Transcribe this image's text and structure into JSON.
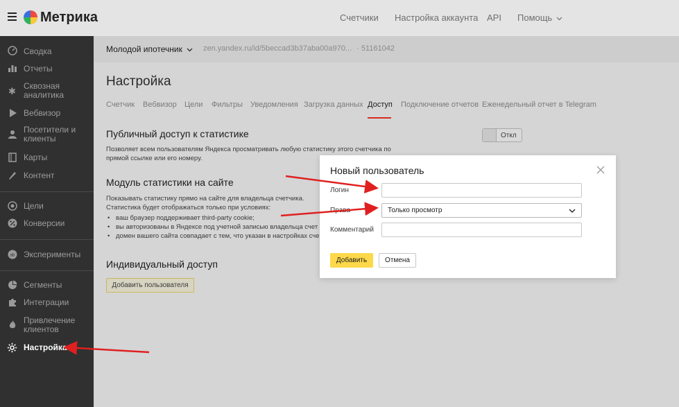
{
  "app": {
    "brand": "Метрика",
    "top_nav": [
      "Счетчики",
      "Настройка аккаунта",
      "API",
      "Помощь"
    ]
  },
  "sidebar": {
    "items": [
      {
        "label": "Сводка",
        "icon": "gauge-icon"
      },
      {
        "label": "Отчеты",
        "icon": "bar-chart-icon"
      },
      {
        "label": "Сквозная аналитика",
        "icon": "snowflake-icon"
      },
      {
        "label": "Вебвизор",
        "icon": "play-icon"
      },
      {
        "label": "Посетители и клиенты",
        "icon": "person-icon"
      },
      {
        "label": "Карты",
        "icon": "map-icon"
      },
      {
        "label": "Контент",
        "icon": "pencil-icon"
      },
      {
        "label": "Цели",
        "icon": "target-icon"
      },
      {
        "label": "Конверсии",
        "icon": "percent-icon"
      },
      {
        "label": "Эксперименты",
        "icon": "ab-icon"
      },
      {
        "label": "Сегменты",
        "icon": "pie-icon"
      },
      {
        "label": "Интеграции",
        "icon": "puzzle-icon"
      },
      {
        "label": "Привлечение клиентов",
        "icon": "flame-icon"
      },
      {
        "label": "Настройка",
        "icon": "gear-icon"
      }
    ]
  },
  "counter": {
    "name": "Молодой ипотечник",
    "url": "zen.yandex.ru/id/5beccad3b37aba00a970...",
    "id": "· 51161042"
  },
  "page": {
    "title": "Настройка",
    "tabs": [
      "Счетчик",
      "Вебвизор",
      "Цели",
      "Фильтры",
      "Уведомления",
      "Загрузка данных",
      "Доступ",
      "Подключение отчетов",
      "Еженедельный отчет в Telegram"
    ],
    "active_tab": "Доступ"
  },
  "public_access": {
    "title": "Публичный доступ к статистике",
    "description_line1": "Позволяет всем пользователям Яндекса просматривать любую статистику этого счетчика по",
    "description_line2": "прямой ссылке или его номеру.",
    "toggle_label": "Откл"
  },
  "stats_module": {
    "title": "Модуль статистики на сайте",
    "line1": "Показывать статистику прямо на сайте для владельца счетчика.",
    "line2": "Статистика будет отображаться только при условиях:",
    "bullets": [
      "ваш браузер поддерживает third-party cookie;",
      "вы авторизованы в Яндексе под учетной записью владельца счет",
      "домен вашего сайта совпадает с тем, что указан в настройках сче"
    ]
  },
  "individual_access": {
    "title": "Индивидуальный доступ",
    "add_user_button": "Добавить пользователя"
  },
  "modal": {
    "title": "Новый пользователь",
    "login_label": "Логин",
    "login_value": "",
    "rights_label": "Права",
    "rights_value": "Только просмотр",
    "comment_label": "Комментарий",
    "comment_value": "",
    "add_button": "Добавить",
    "cancel_button": "Отмена"
  },
  "colors": {
    "accent": "#fcd84a",
    "sidebar_bg": "#303030",
    "active_tab_underline": "#d62d20",
    "annotation_arrow": "#e02020"
  }
}
